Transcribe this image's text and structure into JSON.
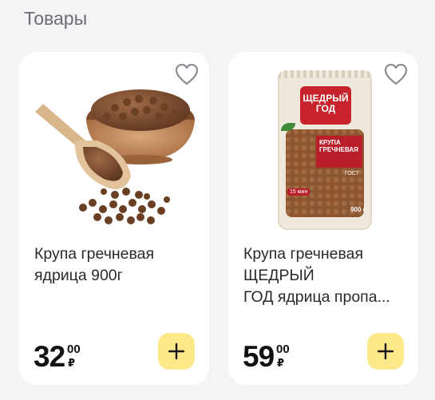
{
  "section": {
    "title": "Товары"
  },
  "products": [
    {
      "title_lines": [
        "Крупа гречневая",
        "ядрица 900г"
      ],
      "price_main": "32",
      "price_cents": "00",
      "currency": "₽",
      "favorite_icon": "heart-outline-icon",
      "add_icon": "plus-icon",
      "accent": "#fde98a"
    },
    {
      "title_lines": [
        "Крупа гречневая",
        "ЩЕДРЫЙ",
        "ГОД ядрица пропа..."
      ],
      "price_main": "59",
      "price_cents": "00",
      "currency": "₽",
      "favorite_icon": "heart-outline-icon",
      "add_icon": "plus-icon",
      "accent": "#fde98a",
      "package": {
        "brand_line1": "ЩЕДРЫЙ",
        "brand_line2": "ГОД",
        "label_line1": "КРУПА",
        "label_line2": "ГРЕЧНЕВАЯ",
        "standard": "ГОСТ",
        "weight": "900 г",
        "cook_time": "15 мин"
      }
    }
  ]
}
